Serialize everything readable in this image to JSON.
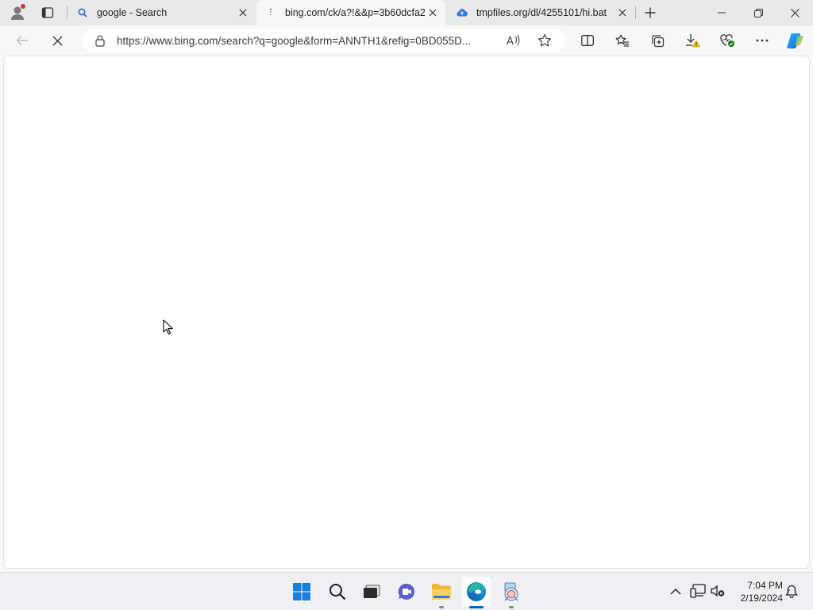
{
  "browser": {
    "tabs": [
      {
        "title": "google - Search",
        "favicon": "search-icon",
        "active": false
      },
      {
        "title": "bing.com/ck/a?!&&p=3b60dcfa2",
        "favicon": "loading-icon",
        "active": true
      },
      {
        "title": "tmpfiles.org/dl/4255101/hi.bat",
        "favicon": "cloud-upload-icon",
        "active": false
      }
    ],
    "new_tab_label": "+",
    "address_bar": {
      "url": "https://www.bing.com/search?q=google&form=ANNTH1&refig=0BD055D...",
      "secure_icon": "lock-icon"
    },
    "toolbar_icons": [
      "back-icon",
      "stop-loading-icon",
      "read-aloud-icon",
      "favorite-star-icon",
      "split-screen-icon",
      "favorites-icon",
      "collections-icon",
      "downloads-warning-icon",
      "browser-essentials-icon",
      "more-options-icon",
      "copilot-icon"
    ],
    "window_controls": [
      "minimize-icon",
      "restore-icon",
      "close-icon"
    ]
  },
  "taskbar": {
    "apps": [
      "start-icon",
      "search-icon",
      "task-view-icon",
      "chat-icon",
      "file-explorer-icon",
      "edge-icon",
      "app-icon"
    ],
    "clock": {
      "time": "7:04 PM",
      "date": "2/19/2024"
    },
    "tray_icons": [
      "show-hidden-icons-chevron",
      "network-icon",
      "volume-muted-icon",
      "notifications-icon"
    ]
  },
  "colors": {
    "accent": "#0067c0",
    "notification_dot": "#d13438",
    "warning": "#f5c400"
  }
}
